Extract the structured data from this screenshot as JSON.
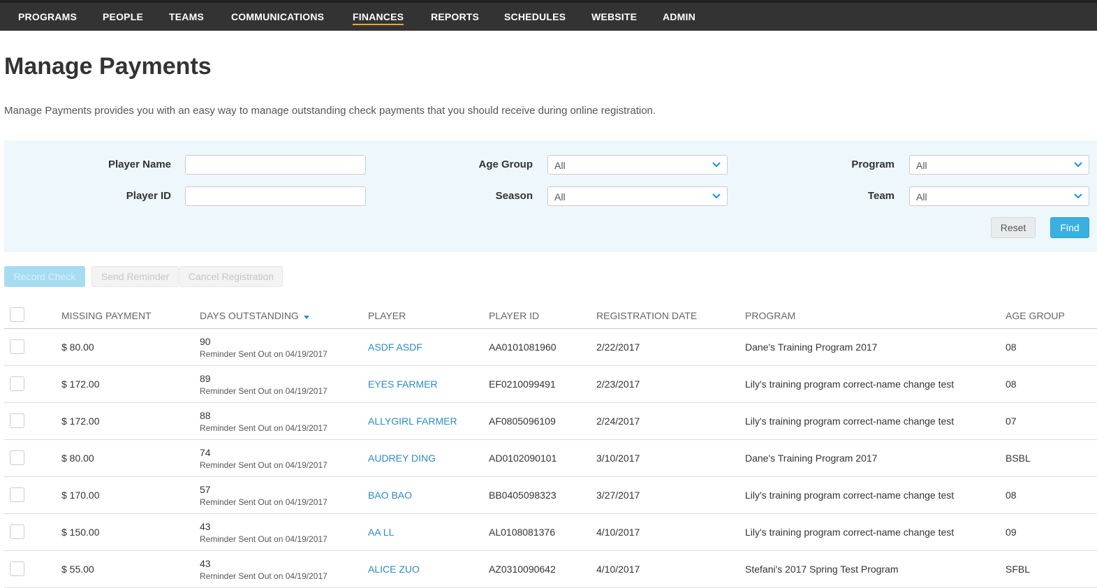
{
  "nav": {
    "items": [
      {
        "label": "PROGRAMS"
      },
      {
        "label": "PEOPLE"
      },
      {
        "label": "TEAMS"
      },
      {
        "label": "COMMUNICATIONS"
      },
      {
        "label": "FINANCES"
      },
      {
        "label": "REPORTS"
      },
      {
        "label": "SCHEDULES"
      },
      {
        "label": "WEBSITE"
      },
      {
        "label": "ADMIN"
      }
    ],
    "active": "FINANCES",
    "accent_color": "#f0a830"
  },
  "page": {
    "title": "Manage Payments",
    "description": "Manage Payments provides you with an easy way to manage outstanding check payments that you should receive during online registration."
  },
  "filters": {
    "player_name_label": "Player Name",
    "player_name_value": "",
    "player_id_label": "Player ID",
    "player_id_value": "",
    "age_group_label": "Age Group",
    "age_group_value": "All",
    "season_label": "Season",
    "season_value": "All",
    "program_label": "Program",
    "program_value": "All",
    "team_label": "Team",
    "team_value": "All",
    "reset_label": "Reset",
    "find_label": "Find"
  },
  "actions": {
    "record_check": "Record Check",
    "send_reminder": "Send Reminder",
    "cancel_registration": "Cancel Registration"
  },
  "table": {
    "headers": {
      "missing_payment": "MISSING PAYMENT",
      "days_outstanding": "DAYS OUTSTANDING",
      "player": "PLAYER",
      "player_id": "PLAYER ID",
      "registration_date": "REGISTRATION DATE",
      "program": "PROGRAM",
      "age_group": "AGE GROUP"
    },
    "sort_column": "days_outstanding",
    "rows": [
      {
        "payment": "$ 80.00",
        "days": "90",
        "reminder": "Reminder Sent Out on 04/19/2017",
        "player": "ASDF ASDF",
        "player_id": "AA0101081960",
        "reg_date": "2/22/2017",
        "program": "Dane's Training Program 2017",
        "age_group": "08"
      },
      {
        "payment": "$ 172.00",
        "days": "89",
        "reminder": "Reminder Sent Out on 04/19/2017",
        "player": "EYES FARMER",
        "player_id": "EF0210099491",
        "reg_date": "2/23/2017",
        "program": "Lily's training program correct-name change test",
        "age_group": "08"
      },
      {
        "payment": "$ 172.00",
        "days": "88",
        "reminder": "Reminder Sent Out on 04/19/2017",
        "player": "ALLYGIRL FARMER",
        "player_id": "AF0805096109",
        "reg_date": "2/24/2017",
        "program": "Lily's training program correct-name change test",
        "age_group": "07"
      },
      {
        "payment": "$ 80.00",
        "days": "74",
        "reminder": "Reminder Sent Out on 04/19/2017",
        "player": "AUDREY DING",
        "player_id": "AD0102090101",
        "reg_date": "3/10/2017",
        "program": "Dane's Training Program 2017",
        "age_group": "BSBL"
      },
      {
        "payment": "$ 170.00",
        "days": "57",
        "reminder": "Reminder Sent Out on 04/19/2017",
        "player": "BAO BAO",
        "player_id": "BB0405098323",
        "reg_date": "3/27/2017",
        "program": "Lily's training program correct-name change test",
        "age_group": "08"
      },
      {
        "payment": "$ 150.00",
        "days": "43",
        "reminder": "Reminder Sent Out on 04/19/2017",
        "player": "AA LL",
        "player_id": "AL0108081376",
        "reg_date": "4/10/2017",
        "program": "Lily's training program correct-name change test",
        "age_group": "09"
      },
      {
        "payment": "$ 55.00",
        "days": "43",
        "reminder": "Reminder Sent Out on 04/19/2017",
        "player": "ALICE ZUO",
        "player_id": "AZ0310090642",
        "reg_date": "4/10/2017",
        "program": "Stefani's 2017 Spring Test Program",
        "age_group": "SFBL"
      }
    ]
  }
}
